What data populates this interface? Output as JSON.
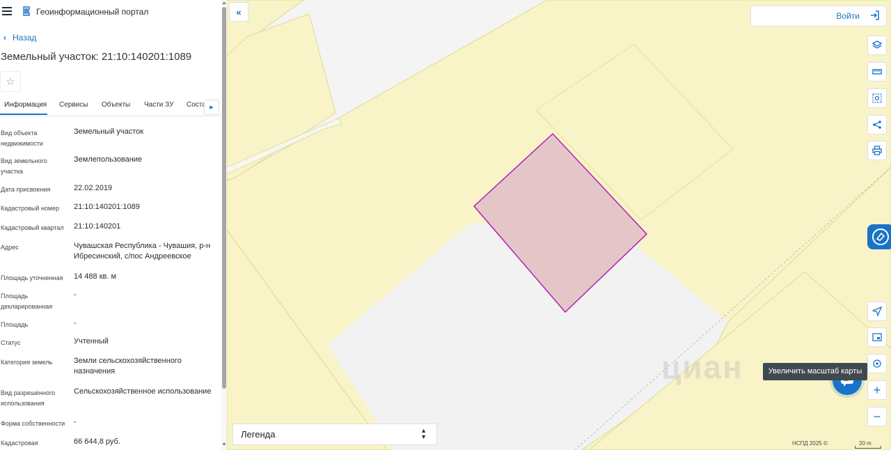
{
  "header": {
    "portal_title": "Геоинформационный портал"
  },
  "nav": {
    "back_label": "Назад"
  },
  "object": {
    "title": "Земельный участок: 21:10:140201:1089"
  },
  "tabs": [
    {
      "label": "Информация",
      "active": true
    },
    {
      "label": "Сервисы"
    },
    {
      "label": "Объекты"
    },
    {
      "label": "Части ЗУ"
    },
    {
      "label": "Соста"
    }
  ],
  "info": [
    {
      "label": "Вид объекта недвижимости",
      "value": "Земельный участок"
    },
    {
      "label": "Вид земельного участка",
      "value": "Землепользование"
    },
    {
      "label": "Дата присвоения",
      "value": "22.02.2019"
    },
    {
      "label": "Кадастровый номер",
      "value": "21:10:140201:1089"
    },
    {
      "label": "Кадастровый квартал",
      "value": "21:10:140201"
    },
    {
      "label": "Адрес",
      "value": "Чувашская Республика - Чувашия, р-н Ибресинский, с/пос Андреевское"
    },
    {
      "label": "Площадь уточненная",
      "value": "14 488 кв. м"
    },
    {
      "label": "Площадь декларированная",
      "value": "-"
    },
    {
      "label": "Площадь",
      "value": "-"
    },
    {
      "label": "Статус",
      "value": "Учтенный"
    },
    {
      "label": "Категория земель",
      "value": "Земли сельскохозяйственного назначения"
    },
    {
      "label": "Вид разрешенного использования",
      "value": "Сельскохозяйственное использование"
    },
    {
      "label": "Форма собственности",
      "value": "-"
    },
    {
      "label": "Кадастровая",
      "value": "66 644,8 руб."
    }
  ],
  "map": {
    "login_label": "Войти",
    "tooltip": "Увеличить масштаб карты",
    "legend_label": "Легенда",
    "copyright": "НСПД 2025 ©",
    "scale_label": "20 m",
    "zoom_in_label": "+",
    "zoom_out_label": "−",
    "watermark": "циан",
    "colors": {
      "parcel_fill": "#e4c6c8",
      "parcel_stroke": "#b01fb8",
      "land_fill": "#f9f3c8",
      "land_stroke": "#dedb8c",
      "accent": "#1a73c7"
    }
  },
  "icons": {
    "menu": "menu-icon",
    "logo": "portal-logo-icon",
    "star": "star-icon",
    "layers": "layers-icon",
    "ruler": "ruler-icon",
    "select_area": "select-area-icon",
    "share": "share-icon",
    "print": "print-icon",
    "locate": "locate-icon",
    "minimap": "minimap-icon",
    "geolocation": "geolocation-icon",
    "chat": "chat-icon",
    "login": "login-icon"
  }
}
